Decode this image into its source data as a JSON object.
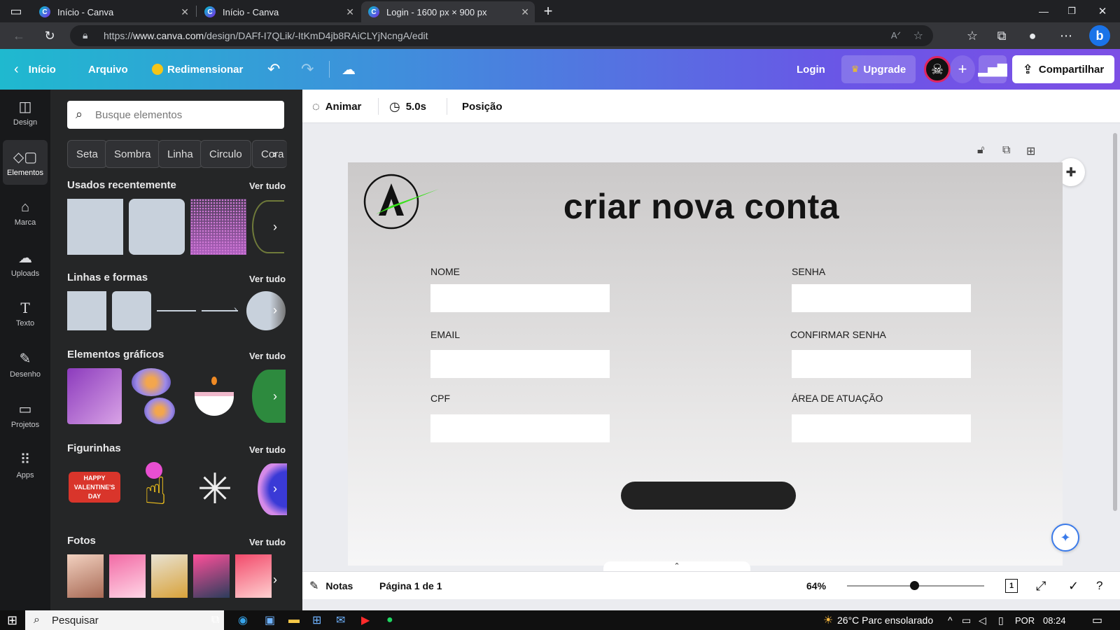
{
  "browser": {
    "tabs": [
      {
        "title": "Início - Canva"
      },
      {
        "title": "Início - Canva"
      },
      {
        "title": "Login - 1600 px × 900 px"
      }
    ],
    "url_scheme": "https://",
    "url_host": "www.canva.com",
    "url_path": "/design/DAFf-I7QLik/-ItKmD4jb8RAiCLYjNcngA/edit",
    "new_tab": "+"
  },
  "canva_bar": {
    "home": "Início",
    "file": "Arquivo",
    "resize": "Redimensionar",
    "login": "Login",
    "upgrade": "Upgrade",
    "share": "Compartilhar"
  },
  "rail": [
    {
      "label": "Design",
      "icon": "layout-icon"
    },
    {
      "label": "Elementos",
      "icon": "shapes-icon"
    },
    {
      "label": "Marca",
      "icon": "brand-icon"
    },
    {
      "label": "Uploads",
      "icon": "cloud-upload-icon"
    },
    {
      "label": "Texto",
      "icon": "text-icon"
    },
    {
      "label": "Desenho",
      "icon": "draw-icon"
    },
    {
      "label": "Projetos",
      "icon": "folder-icon"
    },
    {
      "label": "Apps",
      "icon": "apps-grid-icon"
    }
  ],
  "panel": {
    "search_placeholder": "Busque elementos",
    "chips": [
      "Seta",
      "Sombra",
      "Linha",
      "Circulo",
      "Cora"
    ],
    "sections": [
      {
        "title": "Usados recentemente",
        "see_all": "Ver tudo"
      },
      {
        "title": "Linhas e formas",
        "see_all": "Ver tudo"
      },
      {
        "title": "Elementos gráficos",
        "see_all": "Ver tudo"
      },
      {
        "title": "Figurinhas",
        "see_all": "Ver tudo"
      },
      {
        "title": "Fotos",
        "see_all": "Ver tudo"
      }
    ],
    "sticker_text": "HAPPY VALENTINE'S DAY"
  },
  "toolbar": {
    "animate": "Animar",
    "duration": "5.0s",
    "position": "Posição"
  },
  "design": {
    "title": "criar nova conta",
    "fields": {
      "nome": "NOME",
      "senha": "SENHA",
      "email": "EMAIL",
      "confirmar": "CONFIRMAR SENHA",
      "cpf": "CPF",
      "area": "ÁREA DE ATUAÇÃO"
    }
  },
  "footer": {
    "notes": "Notas",
    "page": "Página 1 de 1",
    "zoom": "64%",
    "zoom_level": 0.64,
    "page_count": "1"
  },
  "taskbar": {
    "search": "Pesquisar",
    "weather": "26°C  Parc ensolarado",
    "lang": "POR",
    "time": "08:24"
  },
  "colors": {
    "accent_teal": "#1fb9cf",
    "accent_purple": "#7c4fe5",
    "logo_green": "#39e01b"
  }
}
